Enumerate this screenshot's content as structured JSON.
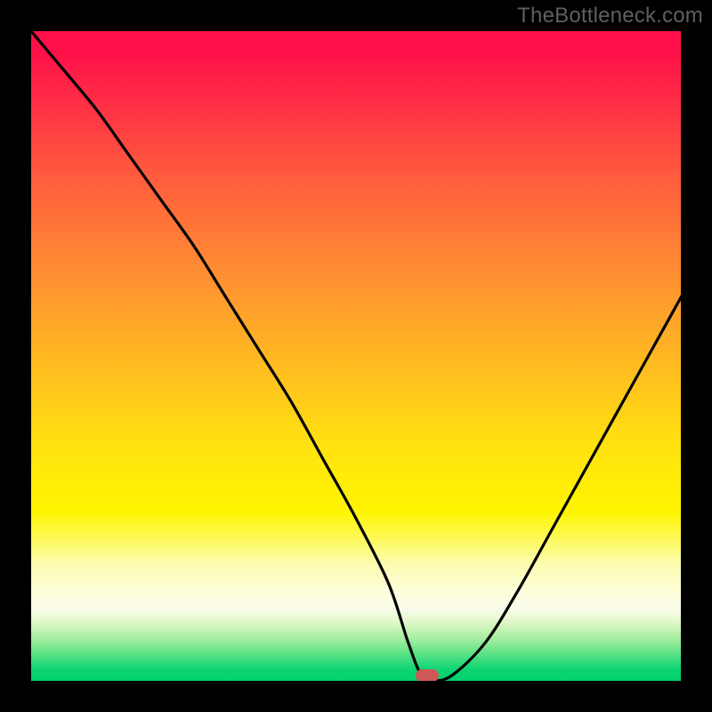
{
  "watermark": "TheBottleneck.com",
  "chart_data": {
    "type": "line",
    "title": "",
    "xlabel": "",
    "ylabel": "",
    "xlim": [
      0,
      100
    ],
    "ylim": [
      0,
      100
    ],
    "x": [
      0,
      5,
      10,
      15,
      20,
      25,
      30,
      35,
      40,
      45,
      50,
      55,
      58,
      60,
      62,
      65,
      70,
      75,
      80,
      85,
      90,
      95,
      100
    ],
    "values": [
      100,
      94,
      88,
      81,
      74,
      67,
      59,
      51,
      43,
      34,
      25,
      15,
      6,
      1,
      0,
      1,
      6,
      14,
      23,
      32,
      41,
      50,
      59
    ],
    "marker": {
      "x": 61,
      "y": 0
    },
    "gradient_stops": [
      {
        "pos": 0,
        "color": "#ff1049"
      },
      {
        "pos": 50,
        "color": "#ffe20f"
      },
      {
        "pos": 90,
        "color": "#fdfddc"
      },
      {
        "pos": 100,
        "color": "#02d16e"
      }
    ]
  }
}
